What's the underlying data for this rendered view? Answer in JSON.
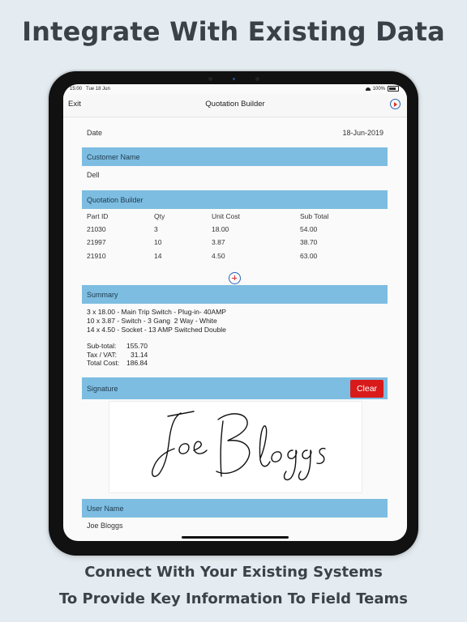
{
  "page": {
    "headline": "Integrate With Existing Data",
    "tagline_line1": "Connect With Your Existing Systems",
    "tagline_line2": "To Provide Key Information To Field Teams"
  },
  "statusbar": {
    "time": "15:00",
    "date": "Tue 18 Jun",
    "battery": "100%"
  },
  "nav": {
    "exit_label": "Exit",
    "title": "Quotation Builder",
    "play_icon": "play-icon"
  },
  "form": {
    "date_label": "Date",
    "date_value": "18-Jun-2019",
    "customer_section": "Customer Name",
    "customer_value": "Dell",
    "quotation_section": "Quotation Builder",
    "columns": [
      "Part ID",
      "Qty",
      "Unit Cost",
      "Sub Total"
    ],
    "rows": [
      [
        "21030",
        "3",
        "18.00",
        "54.00"
      ],
      [
        "21997",
        "10",
        "3.87",
        "38.70"
      ],
      [
        "21910",
        "14",
        "4.50",
        "63.00"
      ]
    ],
    "summary_section": "Summary",
    "summary_items": [
      "3 x 18.00 - Main Trip Switch - Plug-in- 40AMP",
      "10 x 3.87 - Switch - 3 Gang  2 Way - White",
      "14 x 4.50 - Socket - 13 AMP Switched Double"
    ],
    "subtotal_label": "Sub-total:",
    "subtotal_value": "155.70",
    "tax_label": "Tax / VAT:",
    "tax_value": "31.14",
    "total_label": "Total Cost:",
    "total_value": "186.84",
    "signature_section": "Signature",
    "clear_label": "Clear",
    "signature_text": "Joe Bloggs",
    "username_section": "User Name",
    "username_value": "Joe Bloggs"
  },
  "colors": {
    "section": "#7dbde1",
    "clear": "#d91a1a",
    "accent": "#2c64b5"
  }
}
